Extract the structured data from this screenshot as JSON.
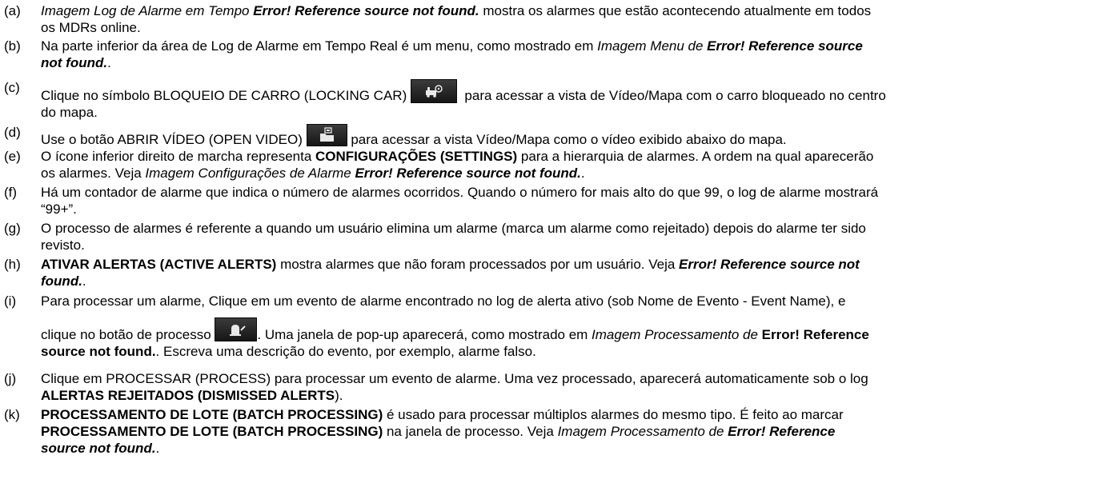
{
  "items": [
    {
      "label": "(a)",
      "line1": [
        {
          "t": "Imagem Log de Alarme em Tempo ",
          "s": "i"
        },
        {
          "t": "Error! Reference source not found.",
          "s": "bi"
        },
        {
          "t": " mostra os alarmes que estão acontecendo atualmente em todos",
          "s": ""
        }
      ],
      "line2": [
        {
          "t": "os MDRs online.",
          "s": ""
        }
      ]
    },
    {
      "label": "(b)",
      "line1": [
        {
          "t": "Na parte inferior da área de Log de Alarme em Tempo Real é um menu, como mostrado em ",
          "s": ""
        },
        {
          "t": "Imagem Menu de ",
          "s": "i"
        },
        {
          "t": "Error! Reference source",
          "s": "bi"
        }
      ],
      "line2": [
        {
          "t": "not found.",
          "s": "bi"
        },
        {
          "t": ".",
          "s": ""
        }
      ]
    },
    {
      "label": "(c)",
      "line1": [
        {
          "t": "Clique no símbolo BLOQUEIO DE CARRO (LOCKING CAR) ",
          "s": ""
        },
        {
          "icon": "locking-car-icon"
        },
        {
          "t": "  para acessar a vista de Vídeo/Mapa com o carro bloqueado no centro",
          "s": ""
        }
      ],
      "line2": [
        {
          "t": "do mapa.",
          "s": ""
        }
      ]
    },
    {
      "label": "(d)",
      "line1": [
        {
          "t": "Use o botão ABRIR VÍDEO (OPEN VIDEO) ",
          "s": ""
        },
        {
          "icon": "open-video-icon"
        },
        {
          "t": " para acessar a vista Vídeo/Mapa como o vídeo exibido abaixo do mapa.",
          "s": ""
        }
      ]
    },
    {
      "label": "(e)",
      "line1": [
        {
          "t": "O ícone inferior direito de marcha representa ",
          "s": ""
        },
        {
          "t": "CONFIGURAÇÕES (SETTINGS)",
          "s": "b"
        },
        {
          "t": " para a hierarquia de alarmes. A ordem na qual aparecerão",
          "s": ""
        }
      ],
      "line2": [
        {
          "t": "os alarmes. Veja ",
          "s": ""
        },
        {
          "t": "Imagem Configurações de Alarme ",
          "s": "i"
        },
        {
          "t": "Error! Reference source not found.",
          "s": "bi"
        },
        {
          "t": ".",
          "s": ""
        }
      ]
    },
    {
      "label": "(f)",
      "line1": [
        {
          "t": "Há um contador de alarme que indica o número de alarmes ocorridos. Quando o número for mais alto do que 99, o log de alarme mostrará",
          "s": ""
        }
      ],
      "line2": [
        {
          "t": "“99+”.",
          "s": ""
        }
      ]
    },
    {
      "label": "(g)",
      "line1": [
        {
          "t": "O processo de alarmes é referente a quando um usuário elimina um alarme (marca um alarme como rejeitado) depois do alarme ter sido",
          "s": ""
        }
      ],
      "line2": [
        {
          "t": "revisto.",
          "s": ""
        }
      ]
    },
    {
      "label": "(h)",
      "line1": [
        {
          "t": "ATIVAR ALERTAS (ACTIVE ALERTS)",
          "s": "b"
        },
        {
          "t": " mostra alarmes que não foram processados por um usuário. Veja ",
          "s": ""
        },
        {
          "t": "Error! Reference source not",
          "s": "bi"
        }
      ],
      "line2": [
        {
          "t": "found.",
          "s": "bi"
        },
        {
          "t": ".",
          "s": ""
        }
      ]
    },
    {
      "label": "(i)",
      "line1": [
        {
          "t": "Para processar um alarme, Clique em um evento de alarme encontrado no log de alerta ativo (sob Nome de Evento - Event Name), e",
          "s": ""
        }
      ],
      "line2": [
        {
          "t": "clique no botão de processo ",
          "s": ""
        },
        {
          "icon": "process-alarm-icon"
        },
        {
          "t": ". Uma janela de pop-up aparecerá, como mostrado em ",
          "s": ""
        },
        {
          "t": "Imagem Processamento de ",
          "s": "i"
        },
        {
          "t": "Error! Reference",
          "s": "b"
        }
      ],
      "line3": [
        {
          "t": "source not found.",
          "s": "b"
        },
        {
          "t": ". Escreva uma descrição do evento, por exemplo, alarme falso.",
          "s": ""
        }
      ]
    },
    {
      "label": "(j)",
      "line1": [
        {
          "t": "Clique em PROCESSAR (PROCESS) para processar um evento de alarme. Uma vez processado, aparecerá automaticamente sob o log",
          "s": ""
        }
      ],
      "line2": [
        {
          "t": "ALERTAS REJEITADOS (DISMISSED ALERTS",
          "s": "b"
        },
        {
          "t": ").",
          "s": ""
        }
      ]
    },
    {
      "label": "(k)",
      "line1": [
        {
          "t": "PROCESSAMENTO DE LOTE (BATCH PROCESSING)",
          "s": "b"
        },
        {
          "t": " é usado para processar múltiplos alarmes do mesmo tipo. É feito ao marcar",
          "s": ""
        }
      ],
      "line2": [
        {
          "t": "PROCESSAMENTO DE LOTE (BATCH PROCESSING)",
          "s": "b"
        },
        {
          "t": " na janela de processo. Veja ",
          "s": ""
        },
        {
          "t": "Imagem Processamento de ",
          "s": "i"
        },
        {
          "t": "Error! Reference",
          "s": "bi"
        }
      ],
      "line3": [
        {
          "t": "source not found.",
          "s": "bi"
        },
        {
          "t": ".",
          "s": ""
        }
      ]
    }
  ]
}
